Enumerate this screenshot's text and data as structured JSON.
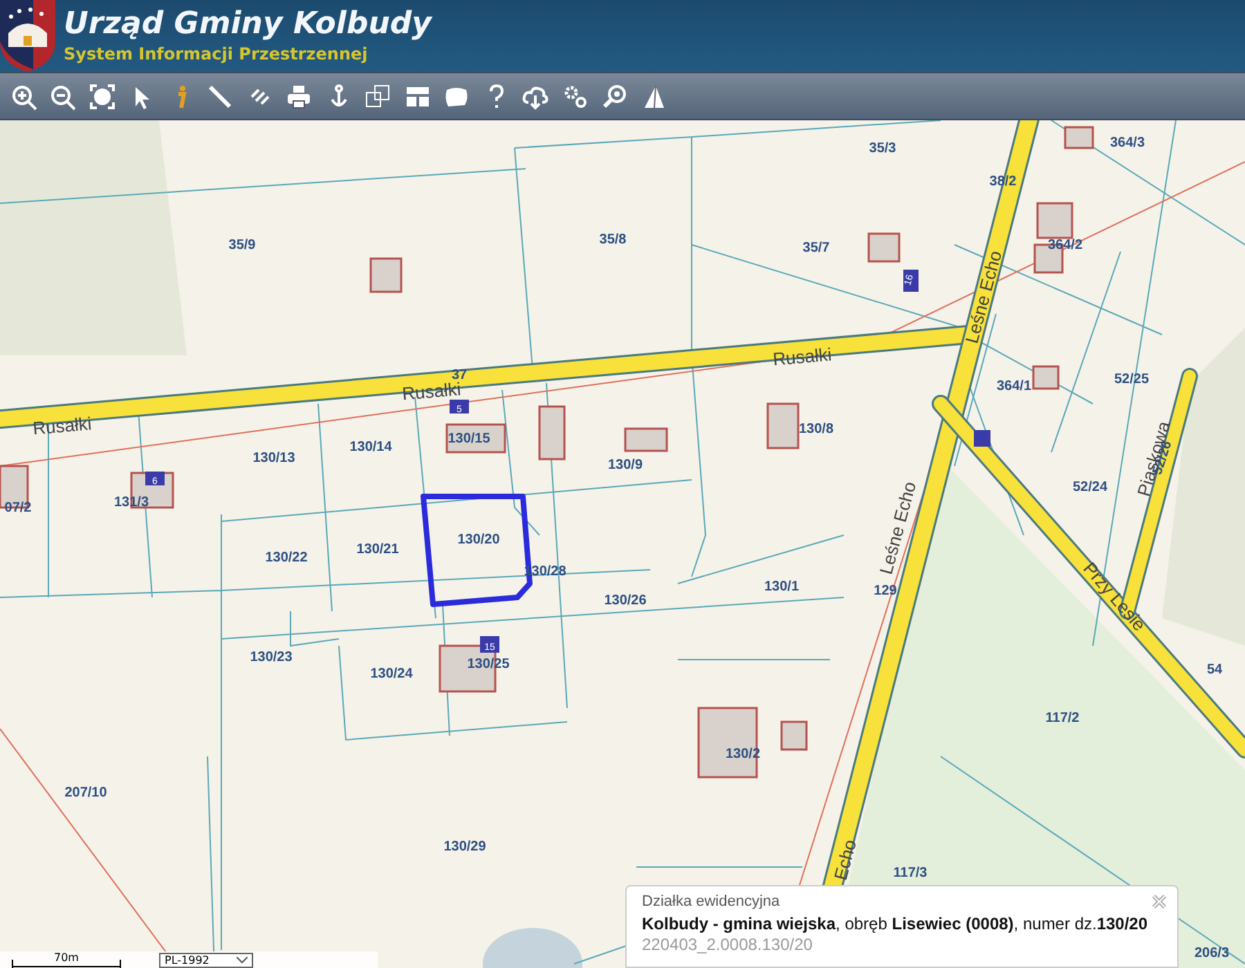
{
  "header": {
    "title": "Urząd Gminy Kolbudy",
    "subtitle": "System Informacji Przestrzennej"
  },
  "map": {
    "parcel_labels": [
      "35/9",
      "35/8",
      "35/7",
      "35/3",
      "364/3",
      "38/2",
      "364/2",
      "364/1",
      "52/25",
      "52/26",
      "52/24",
      "37",
      "130/13",
      "130/14",
      "130/15",
      "130/9",
      "130/8",
      "131/3",
      "07/2",
      "130/22",
      "130/21",
      "130/20",
      "130/28",
      "130/26",
      "130/1",
      "129",
      "130/23",
      "130/24",
      "130/25",
      "54",
      "117/2",
      "130/2",
      "207/10",
      "130/29",
      "117/3",
      "206/3"
    ],
    "street_labels": [
      "Rusałki",
      "Rusałki",
      "Rusałki",
      "Leśne Echo",
      "Leśne Echo",
      "Echo",
      "Przy Lesie",
      "Piaskowa"
    ],
    "building_numbers": [
      "5",
      "6",
      "16",
      "15"
    ]
  },
  "scale": {
    "label": "70m"
  },
  "crs_select": {
    "value": "PL-1992"
  },
  "popup": {
    "title": "Działka ewidencyjna",
    "description": "**Kolbudy - gmina wiejska**, obręb **Lisewiec (0008)**, numer dz.**130/20**",
    "identifier": "220403_2.0008.130/20"
  }
}
